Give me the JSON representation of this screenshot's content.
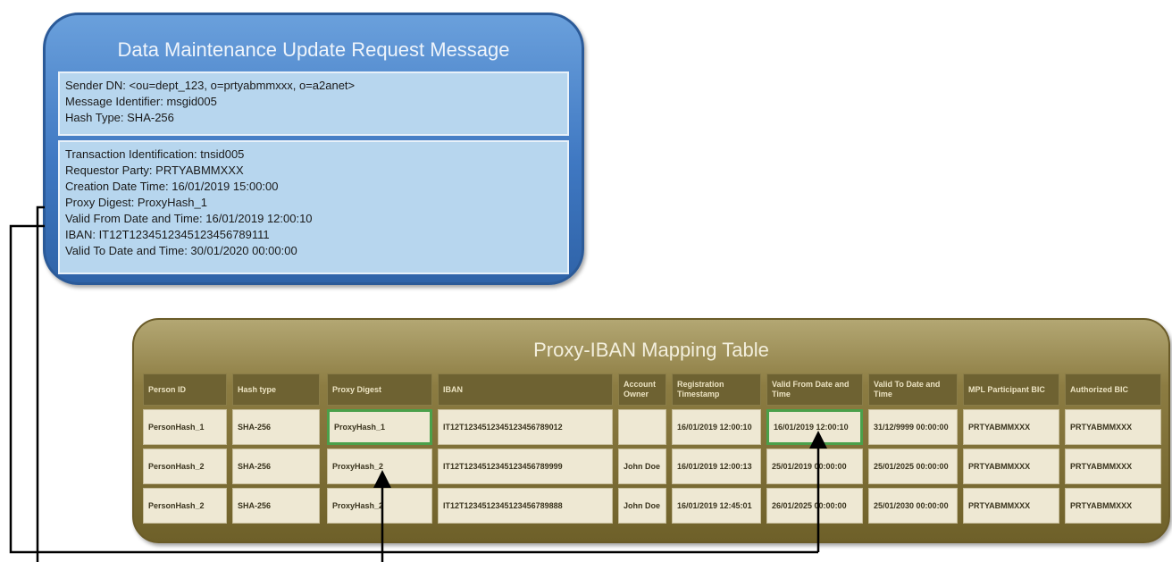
{
  "message": {
    "title": "Data Maintenance Update Request Message",
    "header_lines": [
      "Sender DN: <ou=dept_123, o=prtyabmmxxx, o=a2anet>",
      "Message Identifier: msgid005",
      "Hash Type: SHA-256"
    ],
    "body_lines": [
      "Transaction Identification: tnsid005",
      "Requestor Party: PRTYABMMXXX",
      "Creation Date Time: 16/01/2019 15:00:00",
      "Proxy Digest: ProxyHash_1",
      "Valid From Date and Time: 16/01/2019 12:00:10",
      "IBAN: IT12T1234512345123456789111",
      "Valid To Date and Time: 30/01/2020 00:00:00"
    ]
  },
  "table": {
    "title": "Proxy-IBAN Mapping Table",
    "headers": [
      "Person ID",
      "Hash type",
      "Proxy Digest",
      "IBAN",
      "Account Owner",
      "Registration Timestamp",
      "Valid From Date and Time",
      "Valid To Date and Time",
      "MPL Participant BIC",
      "Authorized BIC"
    ],
    "rows": [
      [
        "PersonHash_1",
        "SHA-256",
        "ProxyHash_1",
        "IT12T1234512345123456789012",
        "",
        "16/01/2019 12:00:10",
        "16/01/2019 12:00:10",
        "31/12/9999 00:00:00",
        "PRTYABMMXXX",
        "PRTYABMMXXX"
      ],
      [
        "PersonHash_2",
        "SHA-256",
        "ProxyHash_2",
        "IT12T1234512345123456789999",
        "John Doe",
        "16/01/2019 12:00:13",
        "25/01/2019 00:00:00",
        "25/01/2025 00:00:00",
        "PRTYABMMXXX",
        "PRTYABMMXXX"
      ],
      [
        "PersonHash_2",
        "SHA-256",
        "ProxyHash_2",
        "IT12T1234512345123456789888",
        "John Doe",
        "16/01/2019 12:45:01",
        "26/01/2025 00:00:00",
        "25/01/2030 00:00:00",
        "PRTYABMMXXX",
        "PRTYABMMXXX"
      ]
    ]
  }
}
